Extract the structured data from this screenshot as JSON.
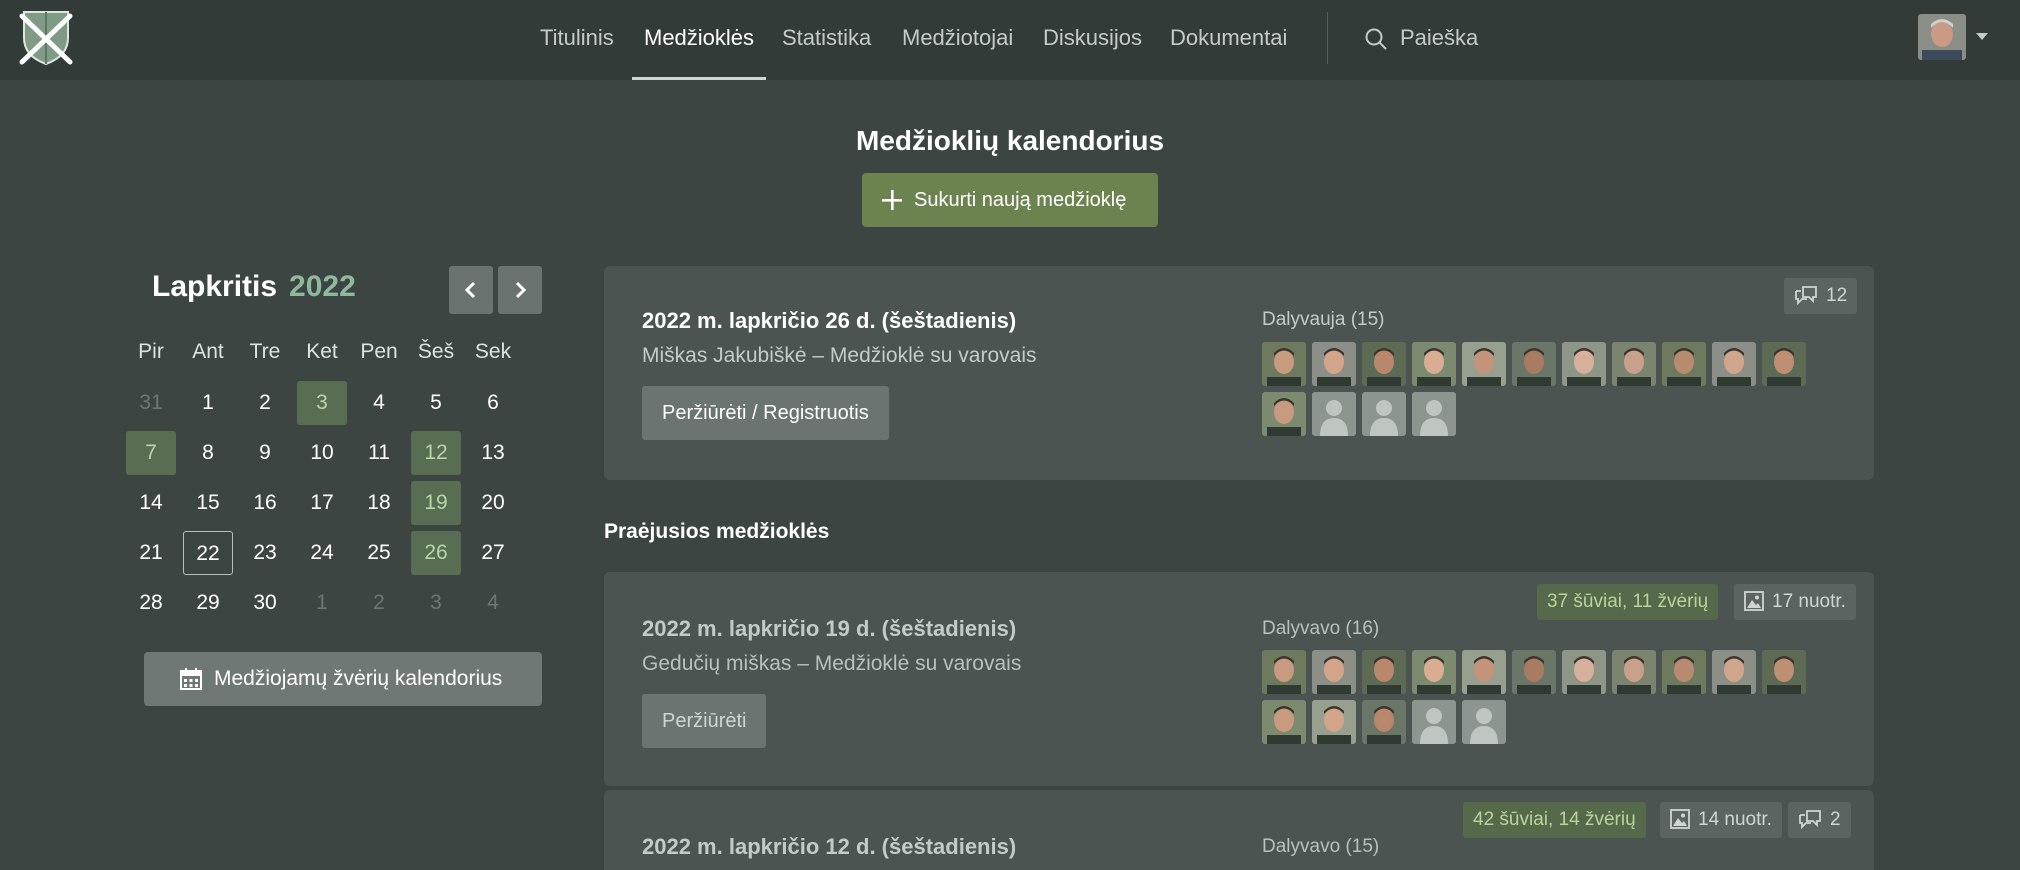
{
  "nav": {
    "items": [
      "Titulinis",
      "Medžioklės",
      "Statistika",
      "Medžiotojai",
      "Diskusijos",
      "Dokumentai"
    ],
    "active_index": 1,
    "search_label": "Paieška"
  },
  "page": {
    "title": "Medžioklių kalendorius",
    "create_button": "Sukurti naują medžioklę"
  },
  "calendar": {
    "month": "Lapkritis",
    "year": "2022",
    "weekdays": [
      "Pir",
      "Ant",
      "Tre",
      "Ket",
      "Pen",
      "Šeš",
      "Sek"
    ],
    "weeks": [
      [
        {
          "d": "31",
          "m": true
        },
        {
          "d": "1"
        },
        {
          "d": "2"
        },
        {
          "d": "3",
          "h": true
        },
        {
          "d": "4"
        },
        {
          "d": "5"
        },
        {
          "d": "6"
        }
      ],
      [
        {
          "d": "7",
          "h": true
        },
        {
          "d": "8"
        },
        {
          "d": "9"
        },
        {
          "d": "10"
        },
        {
          "d": "11"
        },
        {
          "d": "12",
          "h": true
        },
        {
          "d": "13"
        }
      ],
      [
        {
          "d": "14"
        },
        {
          "d": "15"
        },
        {
          "d": "16"
        },
        {
          "d": "17"
        },
        {
          "d": "18"
        },
        {
          "d": "19",
          "h": true
        },
        {
          "d": "20"
        }
      ],
      [
        {
          "d": "21"
        },
        {
          "d": "22",
          "t": true
        },
        {
          "d": "23"
        },
        {
          "d": "24"
        },
        {
          "d": "25"
        },
        {
          "d": "26",
          "h": true
        },
        {
          "d": "27"
        }
      ],
      [
        {
          "d": "28"
        },
        {
          "d": "29"
        },
        {
          "d": "30"
        },
        {
          "d": "1",
          "m": true
        },
        {
          "d": "2",
          "m": true
        },
        {
          "d": "3",
          "m": true
        },
        {
          "d": "4",
          "m": true
        }
      ]
    ],
    "animals_button": "Medžiojamų žvėrių kalendorius"
  },
  "upcoming": {
    "date": "2022 m. lapkričio 26 d. (šeštadienis)",
    "place": "Miškas Jakubiškė – Medžioklė su varovais",
    "button": "Peržiūrėti / Registruotis",
    "participants_label": "Dalyvauja (15)",
    "comments": "12",
    "avatar_count": 15,
    "placeholder_count": 3
  },
  "past_title": "Praėjusios medžioklės",
  "past": [
    {
      "date": "2022 m. lapkričio 19 d. (šeštadienis)",
      "place": "Gedučių miškas – Medžioklė su varovais",
      "button": "Peržiūrėti",
      "participants_label": "Dalyvavo (16)",
      "shots": "37 šūviai, 11 žvėrių",
      "photos": "17 nuotr.",
      "avatar_count": 16,
      "placeholder_count": 2
    },
    {
      "date": "2022 m. lapkričio 12 d. (šeštadienis)",
      "participants_label": "Dalyvavo (15)",
      "shots": "42 šūviai, 14 žvėrių",
      "photos": "14 nuotr.",
      "comments": "2"
    }
  ]
}
